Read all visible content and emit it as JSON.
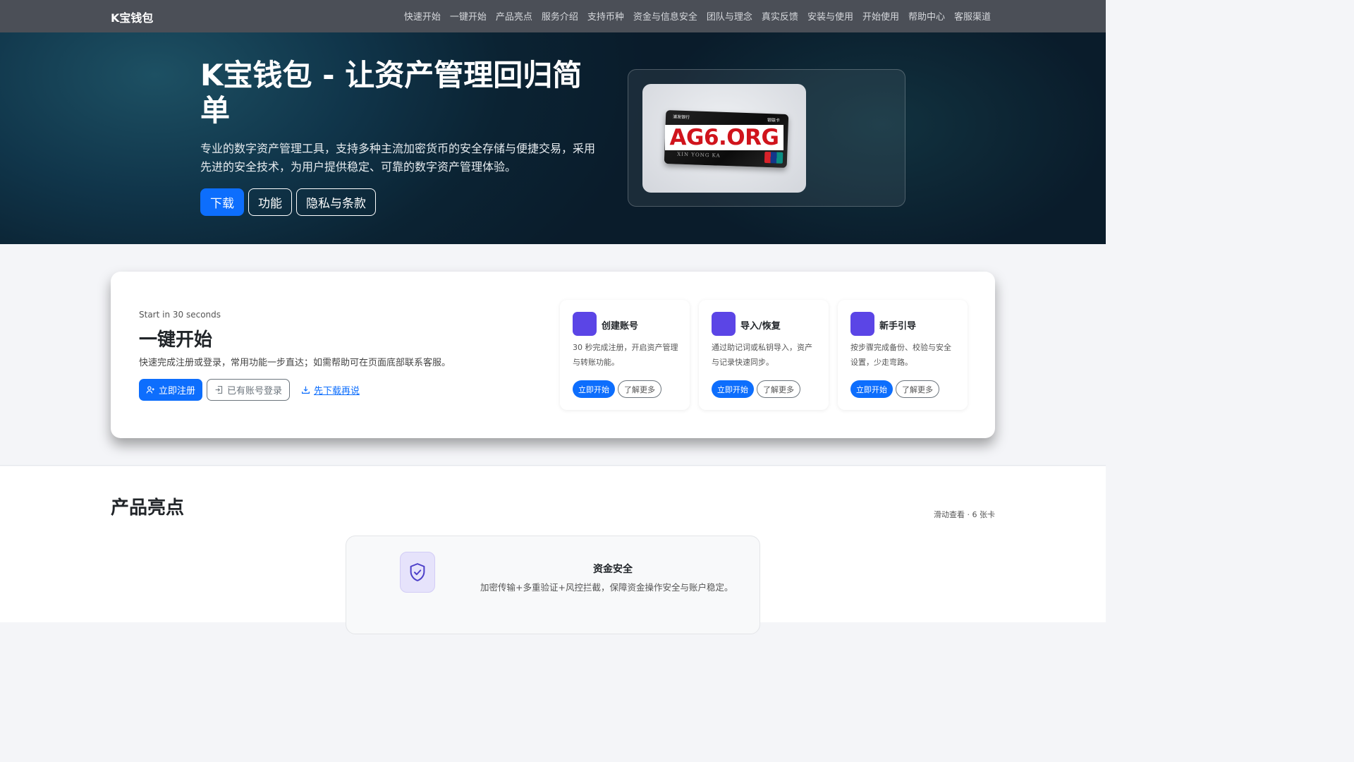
{
  "nav": {
    "brand": "K宝钱包",
    "links": [
      "快速开始",
      "一键开始",
      "产品亮点",
      "服务介绍",
      "支持币种",
      "资金与信息安全",
      "团队与理念",
      "真实反馈",
      "安装与使用",
      "开始使用",
      "帮助中心",
      "客服渠道"
    ]
  },
  "hero": {
    "title": "K宝钱包 - 让资产管理回归简单",
    "description": "专业的数字资产管理工具，支持多种主流加密货币的安全存储与便捷交易，采用先进的安全技术，为用户提供稳定、可靠的数字资产管理体验。",
    "buttons": {
      "download": "下载",
      "features": "功能",
      "privacy": "隐私与条款"
    },
    "image": {
      "watermark": "AG6.ORG",
      "card_bank": "浦发银行",
      "card_type": "银联卡",
      "card_name": "XIN YONG KA"
    }
  },
  "quickstart": {
    "eyebrow": "Start in 30 seconds",
    "title": "一键开始",
    "description": "快速完成注册或登录，常用功能一步直达；如需帮助可在页面底部联系客服。",
    "register_label": "立即注册",
    "login_label": "已有账号登录",
    "download_label": "先下载再说",
    "cards": [
      {
        "title": "创建账号",
        "description": "30 秒完成注册，开启资产管理与转账功能。",
        "primary": "立即开始",
        "secondary": "了解更多"
      },
      {
        "title": "导入/恢复",
        "description": "通过助记词或私钥导入，资产与记录快速同步。",
        "primary": "立即开始",
        "secondary": "了解更多"
      },
      {
        "title": "新手引导",
        "description": "按步骤完成备份、校验与安全设置，少走弯路。",
        "primary": "立即开始",
        "secondary": "了解更多"
      }
    ]
  },
  "highlights": {
    "title": "产品亮点",
    "hint": "滑动查看 · 6 张卡",
    "card": {
      "title": "资金安全",
      "description": "加密传输+多重验证+风控拦截，保障资金操作安全与账户稳定。"
    }
  },
  "colors": {
    "primary": "#0d6efd",
    "accent_icon": "#5b45e6",
    "navbar": "#4b4f57"
  }
}
